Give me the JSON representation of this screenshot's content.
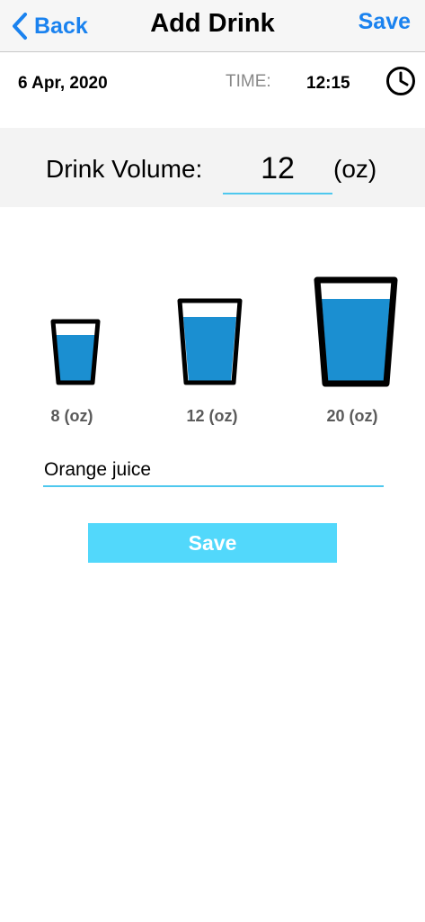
{
  "nav": {
    "back_label": "Back",
    "title": "Add Drink",
    "save_label": "Save"
  },
  "datetime": {
    "date": "6 Apr, 2020",
    "time_label": "TIME:",
    "time_value": "12:15"
  },
  "volume": {
    "label": "Drink Volume:",
    "value": "12",
    "unit": "(oz)"
  },
  "presets": [
    {
      "label": "8 (oz)"
    },
    {
      "label": "12 (oz)"
    },
    {
      "label": "20 (oz)"
    }
  ],
  "drink_name": {
    "value": "Orange juice"
  },
  "save_button": {
    "label": "Save"
  },
  "colors": {
    "accent": "#1a82ef",
    "water": "#1b8fd1",
    "underline": "#4ec8ee",
    "button": "#52d8fb"
  }
}
